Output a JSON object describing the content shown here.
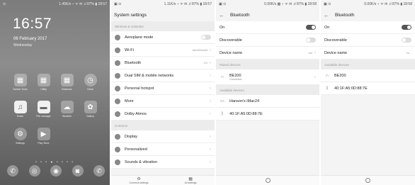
{
  "home": {
    "status_left": "⊙",
    "status_right": "1.45K/s ⋆ ᯤ ✉ .ıl 87% ▮ 18:57",
    "clock": "16:57",
    "date": "06 February 2017",
    "day": "Wednesday",
    "apps": [
      {
        "label": "Screen Tools",
        "icon": "folder-icon",
        "glyph": "▦"
      },
      {
        "label": "Utility",
        "icon": "folder-icon",
        "glyph": "▦"
      },
      {
        "label": "Business",
        "icon": "folder-icon",
        "glyph": "▦"
      },
      {
        "label": "Clock",
        "icon": "clock-icon",
        "glyph": "◷"
      },
      {
        "label": "Music",
        "icon": "music-icon",
        "glyph": "♫"
      },
      {
        "label": "File manager",
        "icon": "file-manager-icon",
        "glyph": "▬"
      },
      {
        "label": "Weather",
        "icon": "weather-icon",
        "glyph": "☁"
      },
      {
        "label": "Gallery",
        "icon": "gallery-icon",
        "glyph": "✿"
      },
      {
        "label": "Settings",
        "icon": "settings-icon",
        "glyph": "⚙"
      },
      {
        "label": "Play Store",
        "icon": "play-store-icon",
        "glyph": "▶"
      }
    ],
    "page_dots": "• • • ● • • • •",
    "dock": [
      {
        "icon": "phone-icon",
        "glyph": "✆"
      },
      {
        "icon": "browser-icon",
        "glyph": "◎"
      },
      {
        "icon": "chrome-icon",
        "glyph": "◉"
      },
      {
        "icon": "camera-icon",
        "glyph": "◙"
      },
      {
        "icon": "whatsapp-icon",
        "glyph": "✆"
      }
    ]
  },
  "settings": {
    "status_left": "▣ ⊙",
    "status_right": "1.11K/s ⋆ ᯤ ✉ .ıl 87% ▮ 18:57",
    "title": "System settings",
    "section_wireless": "Wireless & networks",
    "rows": [
      {
        "label": "Aeroplane mode",
        "value": "",
        "control": "toggle",
        "icon": "aeroplane-icon"
      },
      {
        "label": "Wi-Fi",
        "value": "AlbeDtowelf",
        "control": "chevron",
        "icon": "wifi-icon"
      },
      {
        "label": "Bluetooth",
        "value": "On",
        "control": "chevron",
        "icon": "bluetooth-icon"
      },
      {
        "label": "Dual SIM & mobile networks",
        "value": "",
        "control": "chevron",
        "icon": "sim-icon"
      },
      {
        "label": "Personal hotspot",
        "value": "",
        "control": "chevron",
        "icon": "hotspot-icon"
      },
      {
        "label": "More",
        "value": "",
        "control": "chevron",
        "icon": "more-icon"
      },
      {
        "label": "Dolby Atmos",
        "value": "",
        "control": "chevron",
        "icon": "dolby-icon"
      }
    ],
    "section_common": "Common",
    "rows2": [
      {
        "label": "Display",
        "icon": "display-icon"
      },
      {
        "label": "Personalized",
        "icon": "personalized-icon"
      },
      {
        "label": "Sounds & vibration",
        "icon": "sound-icon"
      }
    ],
    "nav": [
      {
        "label": "Common settings",
        "glyph": "⚙"
      },
      {
        "label": "All settings",
        "glyph": "▦"
      }
    ]
  },
  "bt1": {
    "status_left": "▣ ⊙",
    "status_right": "0.00K/s ▩ ⋆ ᯤ ✉ .ıl 87% ▮ 18:58",
    "title": "Bluetooth",
    "on_label": "On",
    "discoverable_label": "Discoverable",
    "device_name_label": "Device name",
    "device_name_value": "hol",
    "paired_section": "Paired devices",
    "paired": [
      {
        "name": "BE200",
        "sub": "Connected"
      }
    ],
    "available_section": "Available devices",
    "available": [
      {
        "name": "Hanson's iMac24",
        "icon": "laptop-icon",
        "glyph": "▭"
      },
      {
        "name": "40:1F:A5:0D:88:7E",
        "icon": "bluetooth-icon",
        "glyph": "ᛒ"
      }
    ]
  },
  "bt2": {
    "status_left": "▣ ⊙",
    "status_right": "0.00K/s ⋆ ᯤ ✉ .ıl 87% ▮ 18:58",
    "title": "Bluetooth",
    "on_label": "On",
    "discoverable_label": "Discoverable",
    "device_name_label": "Device name",
    "device_name_value": "ho",
    "available_section": "Available devices",
    "available": [
      {
        "name": "BE200",
        "icon": "headphones-icon",
        "glyph": "∩"
      },
      {
        "name": "40:1F:A5:0D:88:7E",
        "icon": "bluetooth-icon",
        "glyph": "ᛒ"
      }
    ]
  }
}
